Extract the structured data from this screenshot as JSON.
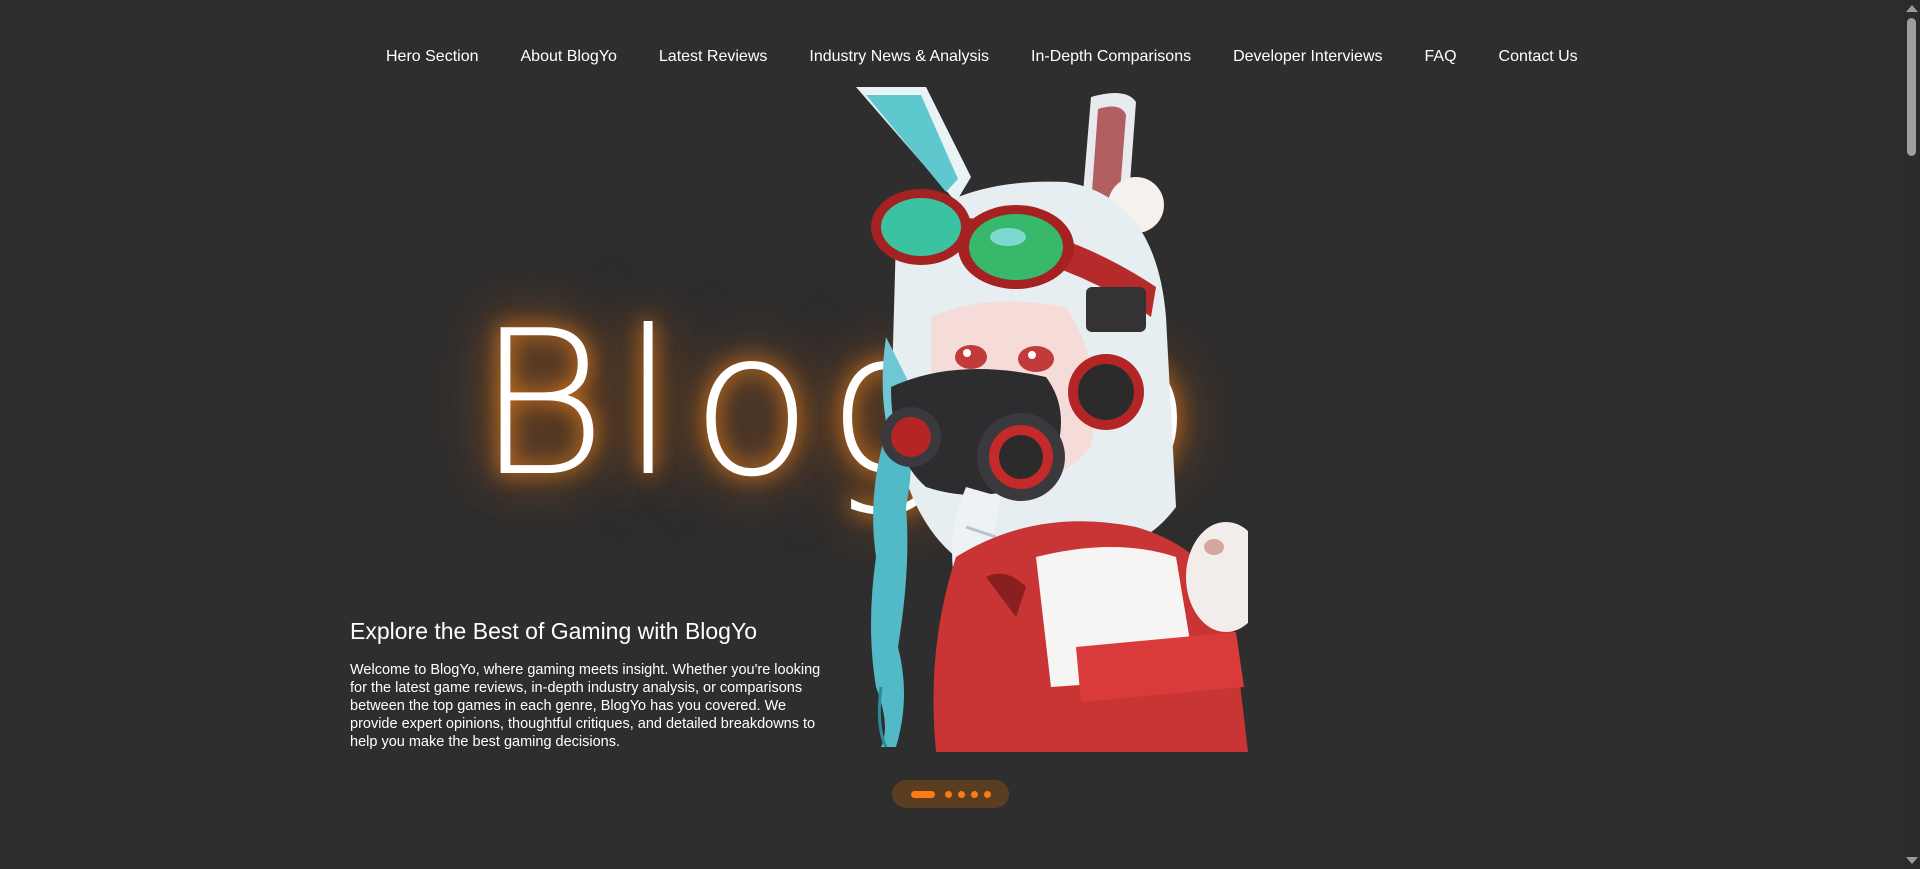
{
  "nav": {
    "items": [
      {
        "label": "Hero Section"
      },
      {
        "label": "About BlogYo"
      },
      {
        "label": "Latest Reviews"
      },
      {
        "label": "Industry News & Analysis"
      },
      {
        "label": "In-Depth Comparisons"
      },
      {
        "label": "Developer Interviews"
      },
      {
        "label": "FAQ"
      },
      {
        "label": "Contact Us"
      }
    ]
  },
  "hero": {
    "big_title": "BlogYo",
    "heading": "Explore the Best of Gaming with BlogYo",
    "body": "Welcome to BlogYo, where gaming meets insight. Whether you're looking for the latest game reviews, in-depth industry analysis, or comparisons between the top games in each genre, BlogYo has you covered. We provide expert opinions, thoughtful critiques, and detailed breakdowns to help you make the best gaming decisions.",
    "art_icon": "anime-bunny-girl-illustration"
  },
  "carousel": {
    "slide_count": 5,
    "active_index": 0
  },
  "colors": {
    "background": "#2e2e2e",
    "accent": "#ff7a10",
    "glow": "#ff8c1e"
  }
}
